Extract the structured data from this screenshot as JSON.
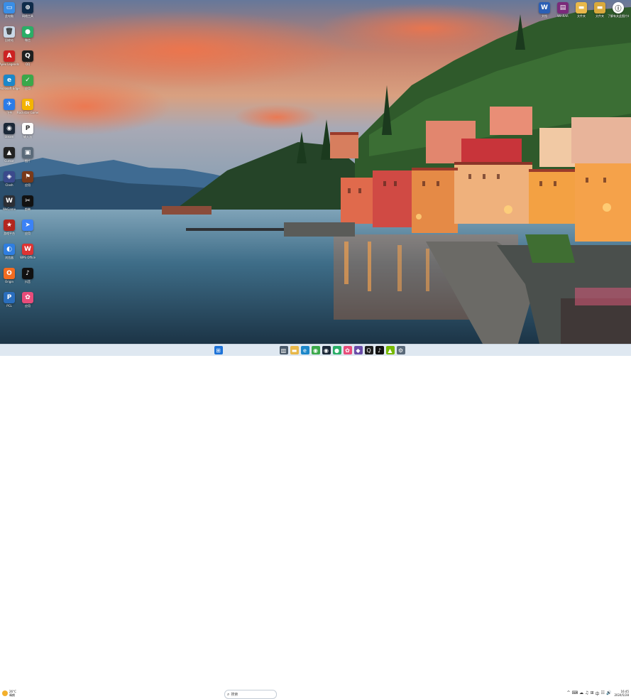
{
  "desktop_icons": [
    {
      "name": "computer-icon",
      "label": "此电脑",
      "color": "#3a8ee6",
      "glyph": "▭"
    },
    {
      "name": "recycle-bin-icon",
      "label": "回收站",
      "color": "#c9d7e6",
      "glyph": "🗑"
    },
    {
      "name": "apex-legends-icon",
      "label": "Apex Legends",
      "color": "#cc2222",
      "glyph": "A"
    },
    {
      "name": "edge-icon",
      "label": "Microsoft Edge",
      "color": "#1c87c9",
      "glyph": "e"
    },
    {
      "name": "feishu-icon",
      "label": "飞书",
      "color": "#2c7ce8",
      "glyph": "✈"
    },
    {
      "name": "steam-icon",
      "label": "Steam",
      "color": "#1b2838",
      "glyph": "◉"
    },
    {
      "name": "cursor-icon",
      "label": "Cursor",
      "color": "#222222",
      "glyph": "▲"
    },
    {
      "name": "clash-icon",
      "label": "Clash",
      "color": "#3b4a8c",
      "glyph": "◈"
    },
    {
      "name": "wegame-icon",
      "label": "WeGame",
      "color": "#2d2f35",
      "glyph": "W"
    },
    {
      "name": "game-platform-icon",
      "label": "游戏平台",
      "color": "#b3261e",
      "glyph": "★"
    },
    {
      "name": "browser-icon",
      "label": "浏览器",
      "color": "#2f7ee0",
      "glyph": "◐"
    },
    {
      "name": "origin-icon",
      "label": "Origin",
      "color": "#f36c21",
      "glyph": "O"
    },
    {
      "name": "pcl-icon",
      "label": "PCL",
      "color": "#2a6ebd",
      "glyph": "P"
    },
    {
      "name": "network-tool-icon",
      "label": "网络工具",
      "color": "#0e2b4a",
      "glyph": "⊕"
    },
    {
      "name": "wechat-icon",
      "label": "微信",
      "color": "#2aae67",
      "glyph": "●"
    },
    {
      "name": "qq-icon",
      "label": "QQ",
      "color": "#1f1f1f",
      "glyph": "Q"
    },
    {
      "name": "green-app-icon",
      "label": "应用",
      "color": "#3aa84a",
      "glyph": "✓"
    },
    {
      "name": "rockstar-icon",
      "label": "Rockstar Games",
      "color": "#f4b400",
      "glyph": "R"
    },
    {
      "name": "pinyin-icon",
      "label": "输入法",
      "color": "#ffffff",
      "glyph": "P"
    },
    {
      "name": "image-app-icon",
      "label": "图片",
      "color": "#5b6b7a",
      "glyph": "▣"
    },
    {
      "name": "flag-app-icon",
      "label": "应用",
      "color": "#7a3a1a",
      "glyph": "⚑"
    },
    {
      "name": "capcut-icon",
      "label": "剪映",
      "color": "#111111",
      "glyph": "✂"
    },
    {
      "name": "send-app-icon",
      "label": "应用",
      "color": "#3b82f6",
      "glyph": "➤"
    },
    {
      "name": "wps-icon",
      "label": "WPS Office",
      "color": "#d33",
      "glyph": "W"
    },
    {
      "name": "tiktok-icon",
      "label": "抖音",
      "color": "#111111",
      "glyph": "♪"
    },
    {
      "name": "pink-app-icon",
      "label": "应用",
      "color": "#e84c7a",
      "glyph": "✿"
    }
  ],
  "top_right_icons": [
    {
      "name": "word-doc-icon",
      "label": "文档",
      "color": "#2b5fb5",
      "glyph": "W"
    },
    {
      "name": "winrar-icon",
      "label": "WinRAR",
      "color": "#7a2a7a",
      "glyph": "▤"
    },
    {
      "name": "folder-icon",
      "label": "文件夹",
      "color": "#e8b84a",
      "glyph": "▬"
    },
    {
      "name": "folder-2-icon",
      "label": "文件夹",
      "color": "#d9a93c",
      "glyph": "▬"
    },
    {
      "name": "info-icon",
      "label": "了解有关此图片的信息",
      "color": "#ffffff",
      "glyph": "ⓘ"
    }
  ],
  "taskbar": {
    "weather_temp": "26°C",
    "weather_desc": "晴朗",
    "search_placeholder": "搜索",
    "apps": [
      {
        "name": "start-icon",
        "color": "#1e73d8",
        "glyph": "⊞"
      },
      {
        "name": "task-view-icon",
        "color": "#4a5a6a",
        "glyph": "▥"
      },
      {
        "name": "file-explorer-icon",
        "color": "#e8b84a",
        "glyph": "▬"
      },
      {
        "name": "edge-taskbar-icon",
        "color": "#1c87c9",
        "glyph": "e"
      },
      {
        "name": "chrome-icon",
        "color": "#3aa84a",
        "glyph": "◉"
      },
      {
        "name": "steam-taskbar-icon",
        "color": "#1b2838",
        "glyph": "◉"
      },
      {
        "name": "wechat-taskbar-icon",
        "color": "#2aae67",
        "glyph": "●"
      },
      {
        "name": "pink-taskbar-icon",
        "color": "#e84c7a",
        "glyph": "✿"
      },
      {
        "name": "app-taskbar-icon",
        "color": "#6a4ca8",
        "glyph": "◆"
      },
      {
        "name": "qq-taskbar-icon",
        "color": "#1f1f1f",
        "glyph": "Q"
      },
      {
        "name": "tiktok-taskbar-icon",
        "color": "#111111",
        "glyph": "♪"
      },
      {
        "name": "nvidia-icon",
        "color": "#76b900",
        "glyph": "▲"
      },
      {
        "name": "settings-taskbar-icon",
        "color": "#5a6a7a",
        "glyph": "⚙"
      }
    ],
    "tray_icons": [
      "^",
      "⌨",
      "☁",
      "♫",
      "⊞",
      "中",
      "☷",
      "🔊"
    ],
    "time": "16:45",
    "date": "2024/5/28"
  }
}
